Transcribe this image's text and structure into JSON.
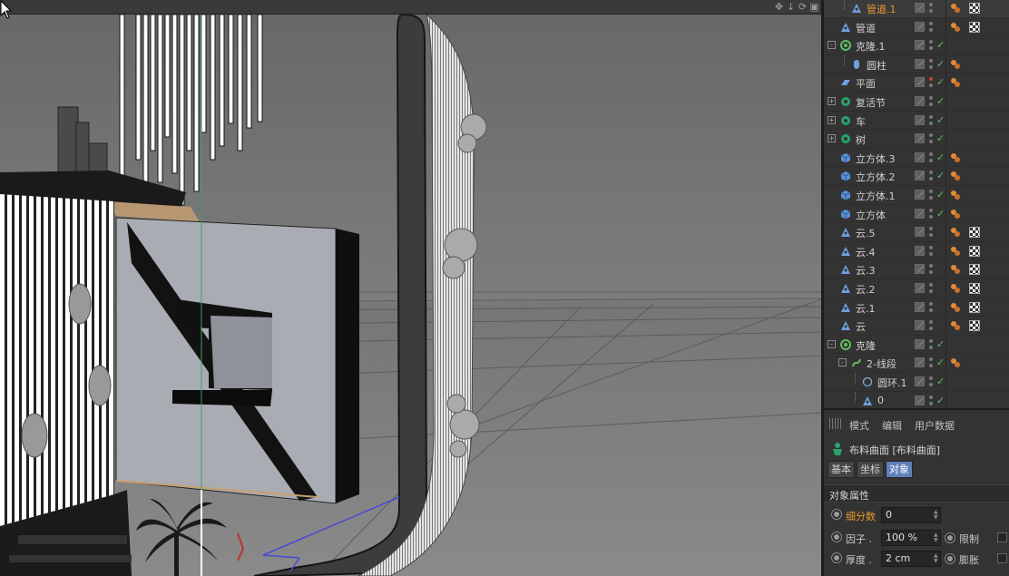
{
  "viewport": {
    "nav_icons": [
      "move-icon",
      "zoom-icon",
      "rotate-icon",
      "maximize-icon"
    ],
    "nav_glyphs": [
      "✥",
      "↓",
      "⟳",
      "▣"
    ]
  },
  "object_manager": {
    "items": [
      {
        "name": "管道.1",
        "icon": "tube-icon",
        "highlight": true,
        "vis": "gray",
        "check": false,
        "tags": [
          "material",
          "checker"
        ]
      },
      {
        "name": "管道",
        "icon": "tube-icon",
        "highlight": false,
        "vis": "gray",
        "check": false,
        "tags": [
          "material",
          "checker"
        ]
      },
      {
        "name": "克隆.1",
        "icon": "cloner-icon",
        "highlight": false,
        "vis": "gray",
        "check": true,
        "tags": []
      },
      {
        "name": "圆柱",
        "icon": "cylinder-icon",
        "highlight": false,
        "vis": "gray",
        "check": true,
        "tags": [
          "material"
        ]
      },
      {
        "name": "平面",
        "icon": "plane-icon",
        "highlight": false,
        "vis": "red",
        "check": true,
        "tags": [
          "material"
        ]
      },
      {
        "name": "复活节",
        "icon": "group-icon",
        "highlight": false,
        "vis": "gray",
        "check": true,
        "tags": []
      },
      {
        "name": "车",
        "icon": "group-icon",
        "highlight": false,
        "vis": "gray",
        "check": true,
        "tags": []
      },
      {
        "name": "树",
        "icon": "group-icon",
        "highlight": false,
        "vis": "gray",
        "check": true,
        "tags": []
      },
      {
        "name": "立方体.3",
        "icon": "cube-icon",
        "highlight": false,
        "vis": "gray",
        "check": true,
        "tags": [
          "material"
        ]
      },
      {
        "name": "立方体.2",
        "icon": "cube-icon",
        "highlight": false,
        "vis": "gray",
        "check": true,
        "tags": [
          "material"
        ]
      },
      {
        "name": "立方体.1",
        "icon": "cube-icon",
        "highlight": false,
        "vis": "gray",
        "check": true,
        "tags": [
          "material"
        ]
      },
      {
        "name": "立方体",
        "icon": "cube-icon",
        "highlight": false,
        "vis": "gray",
        "check": true,
        "tags": [
          "material"
        ]
      },
      {
        "name": "云.5",
        "icon": "cloud-icon",
        "highlight": false,
        "vis": "gray",
        "check": false,
        "tags": [
          "material",
          "checker"
        ]
      },
      {
        "name": "云.4",
        "icon": "cloud-icon",
        "highlight": false,
        "vis": "gray",
        "check": false,
        "tags": [
          "material",
          "checker"
        ]
      },
      {
        "name": "云.3",
        "icon": "cloud-icon",
        "highlight": false,
        "vis": "gray",
        "check": false,
        "tags": [
          "material",
          "checker"
        ]
      },
      {
        "name": "云.2",
        "icon": "cloud-icon",
        "highlight": false,
        "vis": "gray",
        "check": false,
        "tags": [
          "material",
          "checker"
        ]
      },
      {
        "name": "云.1",
        "icon": "cloud-icon",
        "highlight": false,
        "vis": "gray",
        "check": false,
        "tags": [
          "material",
          "checker"
        ]
      },
      {
        "name": "云",
        "icon": "cloud-icon",
        "highlight": false,
        "vis": "gray",
        "check": false,
        "tags": [
          "material",
          "checker"
        ]
      },
      {
        "name": "克隆",
        "icon": "cloner-icon",
        "highlight": false,
        "vis": "gray",
        "check": true,
        "tags": []
      },
      {
        "name": "2-线段",
        "icon": "spline-icon",
        "highlight": false,
        "vis": "gray",
        "check": true,
        "tags": [
          "material"
        ]
      },
      {
        "name": "圆环.1",
        "icon": "circle-icon",
        "highlight": false,
        "vis": "gray",
        "check": true,
        "tags": []
      },
      {
        "name": "0",
        "icon": "tube-icon",
        "highlight": false,
        "vis": "gray",
        "check": true,
        "tags": []
      }
    ]
  },
  "attribute_manager": {
    "menu": [
      "模式",
      "编辑",
      "用户数据"
    ],
    "object_title": "布料曲面 [布料曲面]",
    "tabs": [
      {
        "label": "基本",
        "active": false
      },
      {
        "label": "坐标",
        "active": false
      },
      {
        "label": "对象",
        "active": true
      }
    ],
    "section_title": "对象属性",
    "params": {
      "subdivisions": {
        "label": "细分数",
        "value": "0"
      },
      "factor": {
        "label": "因子 .",
        "value": "100 %"
      },
      "limit": {
        "label": "限制"
      },
      "thickness": {
        "label": "厚度 .",
        "value": "2 cm"
      },
      "expand": {
        "label": "膨胀"
      }
    }
  },
  "colors": {
    "accent_orange": "#e8962e",
    "active_tab": "#5f7fb8",
    "check_green": "#5dc05d",
    "panel_bg": "#333333"
  }
}
